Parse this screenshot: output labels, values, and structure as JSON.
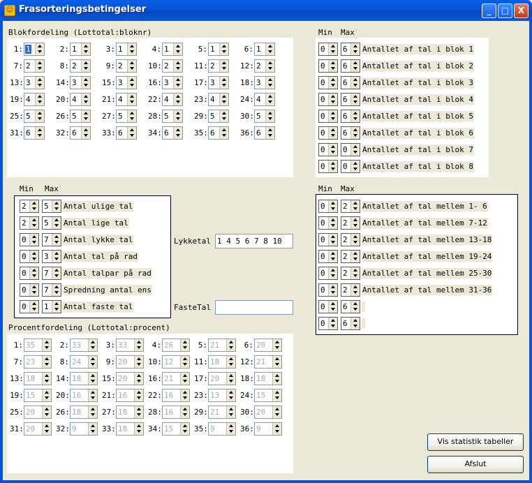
{
  "window": {
    "title": "Frasorteringsbetingelser",
    "controls": [
      "_",
      "□",
      "X"
    ]
  },
  "blok": {
    "title": "Blokfordeling (Lottotal:bloknr)",
    "cells": [
      [
        "1:",
        "1"
      ],
      [
        "2:",
        "1"
      ],
      [
        "3:",
        "1"
      ],
      [
        "4:",
        "1"
      ],
      [
        "5:",
        "1"
      ],
      [
        "6:",
        "1"
      ],
      [
        "7:",
        "2"
      ],
      [
        "8:",
        "2"
      ],
      [
        "9:",
        "2"
      ],
      [
        "10:",
        "2"
      ],
      [
        "11:",
        "2"
      ],
      [
        "12:",
        "2"
      ],
      [
        "13:",
        "3"
      ],
      [
        "14:",
        "3"
      ],
      [
        "15:",
        "3"
      ],
      [
        "16:",
        "3"
      ],
      [
        "17:",
        "3"
      ],
      [
        "18:",
        "3"
      ],
      [
        "19:",
        "4"
      ],
      [
        "20:",
        "4"
      ],
      [
        "21:",
        "4"
      ],
      [
        "22:",
        "4"
      ],
      [
        "23:",
        "4"
      ],
      [
        "24:",
        "4"
      ],
      [
        "25:",
        "5"
      ],
      [
        "26:",
        "5"
      ],
      [
        "27:",
        "5"
      ],
      [
        "28:",
        "5"
      ],
      [
        "29:",
        "5"
      ],
      [
        "30:",
        "5"
      ],
      [
        "31:",
        "6"
      ],
      [
        "32:",
        "6"
      ],
      [
        "33:",
        "6"
      ],
      [
        "34:",
        "6"
      ],
      [
        "35:",
        "6"
      ],
      [
        "36:",
        "6"
      ]
    ]
  },
  "blok_minmax": {
    "min_label": "Min",
    "max_label": "Max",
    "rows": [
      [
        "0",
        "6",
        "Antallet af tal i blok 1"
      ],
      [
        "0",
        "6",
        "Antallet af tal i blok 2"
      ],
      [
        "0",
        "6",
        "Antallet af tal i blok 3"
      ],
      [
        "0",
        "6",
        "Antallet af tal i blok 4"
      ],
      [
        "0",
        "6",
        "Antallet af tal i blok 5"
      ],
      [
        "0",
        "6",
        "Antallet af tal i blok 6"
      ],
      [
        "0",
        "0",
        "Antallet af tal i blok 7"
      ],
      [
        "0",
        "0",
        "Antallet af tal i blok 8"
      ]
    ]
  },
  "stats": {
    "min_label": "Min",
    "max_label": "Max",
    "rows": [
      [
        "2",
        "5",
        "Antal ulige tal"
      ],
      [
        "2",
        "5",
        "Antal lige tal"
      ],
      [
        "0",
        "7",
        "Antal lykke tal"
      ],
      [
        "0",
        "3",
        "Antal tal på rad"
      ],
      [
        "0",
        "7",
        "Antal talpar på rad"
      ],
      [
        "0",
        "7",
        "Spredning antal ens"
      ],
      [
        "0",
        "1",
        "Antal faste tal"
      ]
    ]
  },
  "lykketal": {
    "label": "Lykketal",
    "value": "1 4 5 6 7 8 10"
  },
  "fastetal": {
    "label": "FasteTal",
    "value": ""
  },
  "mellem": {
    "min_label": "Min",
    "max_label": "Max",
    "rows": [
      [
        "0",
        "2",
        "Antallet af tal mellem  1- 6"
      ],
      [
        "0",
        "2",
        "Antallet af tal mellem  7-12"
      ],
      [
        "0",
        "2",
        "Antallet af tal mellem 13-18"
      ],
      [
        "0",
        "2",
        "Antallet af tal mellem 19-24"
      ],
      [
        "0",
        "2",
        "Antallet af tal mellem 25-30"
      ],
      [
        "0",
        "2",
        "Antallet af tal mellem 31-36"
      ],
      [
        "0",
        "6",
        ""
      ],
      [
        "0",
        "6",
        ""
      ]
    ]
  },
  "procent": {
    "title": "Procentfordeling (Lottotal:procent)",
    "cells": [
      [
        "1:",
        "35"
      ],
      [
        "2:",
        "33"
      ],
      [
        "3:",
        "33"
      ],
      [
        "4:",
        "26"
      ],
      [
        "5:",
        "21"
      ],
      [
        "6:",
        "20"
      ],
      [
        "7:",
        "23"
      ],
      [
        "8:",
        "24"
      ],
      [
        "9:",
        "20"
      ],
      [
        "10:",
        "12"
      ],
      [
        "11:",
        "18"
      ],
      [
        "12:",
        "21"
      ],
      [
        "13:",
        "18"
      ],
      [
        "14:",
        "18"
      ],
      [
        "15:",
        "20"
      ],
      [
        "16:",
        "21"
      ],
      [
        "17:",
        "20"
      ],
      [
        "18:",
        "18"
      ],
      [
        "19:",
        "15"
      ],
      [
        "20:",
        "16"
      ],
      [
        "21:",
        "16"
      ],
      [
        "22:",
        "16"
      ],
      [
        "23:",
        "13"
      ],
      [
        "24:",
        "15"
      ],
      [
        "25:",
        "20"
      ],
      [
        "26:",
        "18"
      ],
      [
        "27:",
        "18"
      ],
      [
        "28:",
        "16"
      ],
      [
        "29:",
        "21"
      ],
      [
        "30:",
        "20"
      ],
      [
        "31:",
        "20"
      ],
      [
        "32:",
        "9"
      ],
      [
        "33:",
        "18"
      ],
      [
        "34:",
        "15"
      ],
      [
        "35:",
        "9"
      ],
      [
        "36:",
        "9"
      ]
    ]
  },
  "buttons": {
    "stats": "Vis statistik tabeller",
    "close": "Afslut"
  }
}
